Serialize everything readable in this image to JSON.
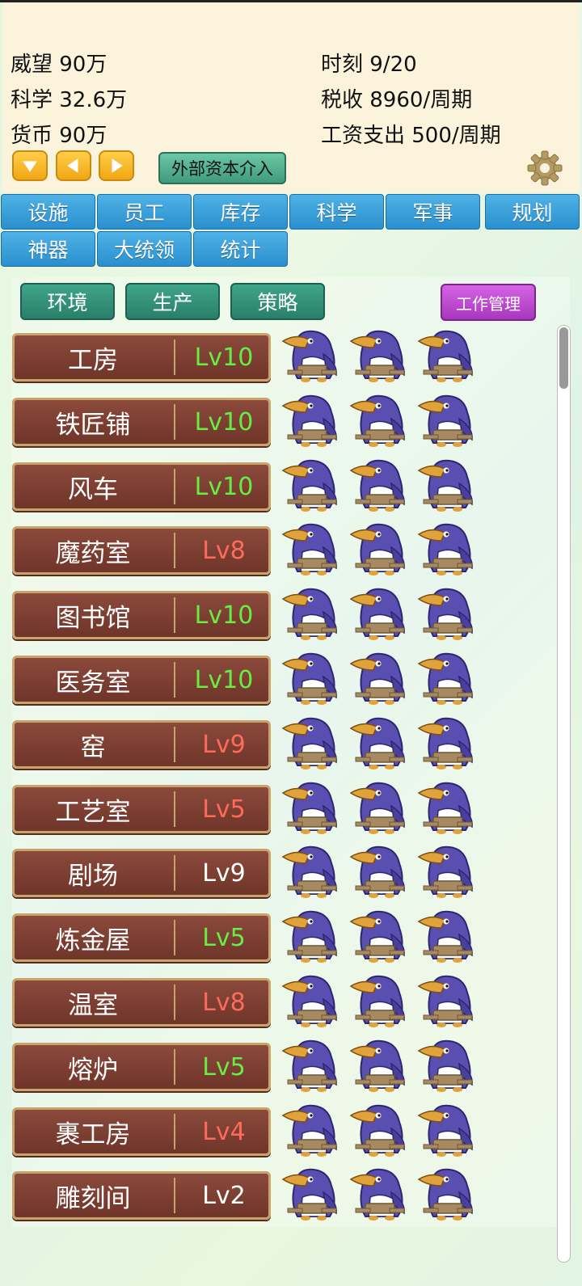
{
  "stats": {
    "prestige": "威望 90万",
    "science": "科学 32.6万",
    "currency": "货币 90万",
    "time": "时刻 9/20",
    "tax": "税收 8960/周期",
    "wage": "工资支出 500/周期"
  },
  "external_button": "外部资本介入",
  "tabs": [
    "设施",
    "员工",
    "库存",
    "科学",
    "军事",
    "规划",
    "神器",
    "大统领",
    "统计"
  ],
  "subtabs": [
    "环境",
    "生产",
    "策略"
  ],
  "work_button": "工作管理",
  "colors": {
    "green_level": "#66ee44",
    "red_level": "#ff6b5b",
    "white_level": "#ffffff"
  },
  "buildings": [
    {
      "name": "工房",
      "level": "Lv10",
      "status": "green"
    },
    {
      "name": "铁匠铺",
      "level": "Lv10",
      "status": "green"
    },
    {
      "name": "风车",
      "level": "Lv10",
      "status": "green"
    },
    {
      "name": "魔药室",
      "level": "Lv8",
      "status": "red"
    },
    {
      "name": "图书馆",
      "level": "Lv10",
      "status": "green"
    },
    {
      "name": "医务室",
      "level": "Lv10",
      "status": "green"
    },
    {
      "name": "窑",
      "level": "Lv9",
      "status": "red"
    },
    {
      "name": "工艺室",
      "level": "Lv5",
      "status": "red"
    },
    {
      "name": "剧场",
      "level": "Lv9",
      "status": "white"
    },
    {
      "name": "炼金屋",
      "level": "Lv5",
      "status": "green"
    },
    {
      "name": "温室",
      "level": "Lv8",
      "status": "red"
    },
    {
      "name": "熔炉",
      "level": "Lv5",
      "status": "green"
    },
    {
      "name": "裹工房",
      "level": "Lv4",
      "status": "red"
    },
    {
      "name": "雕刻间",
      "level": "Lv2",
      "status": "white"
    }
  ],
  "workers_per_building": 3,
  "icons": {
    "down": "arrow-down-icon",
    "left": "arrow-left-icon",
    "right": "arrow-right-icon",
    "settings": "gear-icon",
    "worker": "penguin-worker-icon"
  }
}
